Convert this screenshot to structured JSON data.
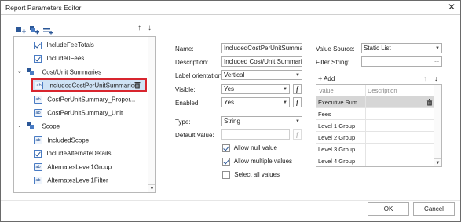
{
  "window": {
    "title": "Report Parameters Editor",
    "close_glyph": "✕"
  },
  "toolbar": {
    "icons": [
      "add-parameter-icon",
      "add-group-icon",
      "add-separator-icon"
    ],
    "move_up_glyph": "↑",
    "move_down_glyph": "↓"
  },
  "tree": {
    "items": [
      {
        "label": "IncludeFeeTotals",
        "kind": "checkbox",
        "checked": true
      },
      {
        "label": "Include0Fees",
        "kind": "checkbox",
        "checked": true
      },
      {
        "label": "Cost/Unit Summaries",
        "kind": "group",
        "expanded": true
      },
      {
        "label": "IncludedCostPerUnitSummaries",
        "kind": "field",
        "selected": true
      },
      {
        "label": "CostPerUnitSummary_Proper...",
        "kind": "field"
      },
      {
        "label": "CostPerUnitSummary_Unit",
        "kind": "field"
      },
      {
        "label": "Scope",
        "kind": "group",
        "expanded": true
      },
      {
        "label": "IncludedScope",
        "kind": "field"
      },
      {
        "label": "IncludeAlternateDetails",
        "kind": "checkbox",
        "checked": true
      },
      {
        "label": "AlternatesLevel1Group",
        "kind": "field"
      },
      {
        "label": "AlternatesLevel1Filter",
        "kind": "field"
      }
    ],
    "field_icon_text": "ab",
    "delete_icon": "trash-icon"
  },
  "props": {
    "name_label": "Name:",
    "name_value": "IncludedCostPerUnitSummaries",
    "description_label": "Description:",
    "description_value": "Included Cost/Unit Summaries",
    "label_orientation_label": "Label orientation:",
    "label_orientation_value": "Vertical",
    "visible_label": "Visible:",
    "visible_value": "Yes",
    "enabled_label": "Enabled:",
    "enabled_value": "Yes",
    "type_label": "Type:",
    "type_value": "String",
    "default_value_label": "Default Value:",
    "default_value_value": "",
    "expr_glyph": "f",
    "allow_null_label": "Allow null value",
    "allow_null_checked": true,
    "allow_multiple_label": "Allow multiple values",
    "allow_multiple_checked": true,
    "select_all_label": "Select all values",
    "select_all_checked": false
  },
  "values_panel": {
    "value_source_label": "Value Source:",
    "value_source_value": "Static List",
    "filter_string_label": "Filter String:",
    "filter_ellipsis": "...",
    "add_label": "Add",
    "add_glyph": "+",
    "columns": [
      "Value",
      "Description"
    ],
    "rows": [
      "Executive Sum...",
      "Fees",
      "Level 1 Group",
      "Level 2 Group",
      "Level 3 Group",
      "Level 4 Group"
    ],
    "active_row": 0
  },
  "footer": {
    "ok_label": "OK",
    "cancel_label": "Cancel"
  },
  "colors": {
    "selection_border": "#d8252e",
    "selection_fill": "#cfe3f5",
    "accent": "#2b5797"
  }
}
